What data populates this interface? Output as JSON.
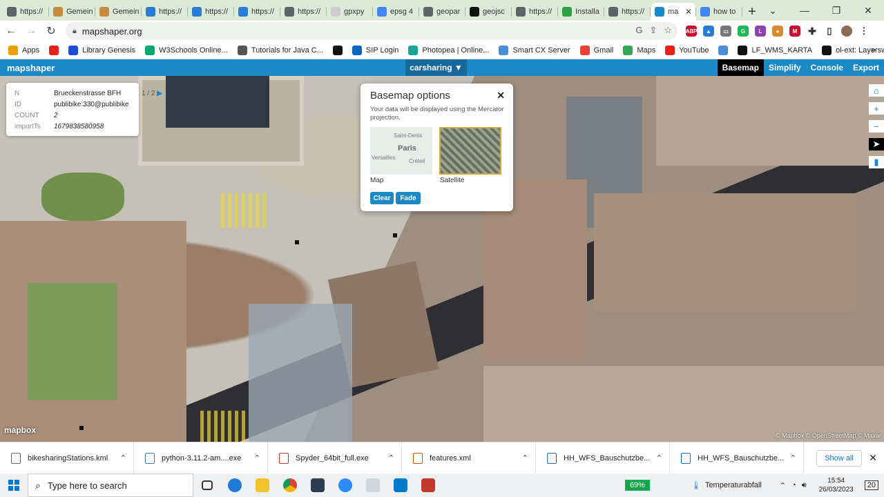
{
  "browser": {
    "tabs": [
      {
        "title": "https://",
        "color": "#5f6368",
        "icon": "globe-icon"
      },
      {
        "title": "Gemein",
        "color": "#c58a3c",
        "icon": "grid-icon"
      },
      {
        "title": "Gemein",
        "color": "#c58a3c",
        "icon": "grid-icon"
      },
      {
        "title": "https://",
        "color": "#2a7bd6",
        "icon": "bird-icon"
      },
      {
        "title": "https://",
        "color": "#2a7bd6",
        "icon": "bird-icon"
      },
      {
        "title": "https://",
        "color": "#2a7bd6",
        "icon": "bird-icon"
      },
      {
        "title": "https://",
        "color": "#5f6368",
        "icon": "globe-icon"
      },
      {
        "title": "gpxpy",
        "color": "#cccccc",
        "icon": "blank-icon"
      },
      {
        "title": "epsg 4",
        "color": "#4285f4",
        "icon": "google-icon"
      },
      {
        "title": "geopar",
        "color": "#5f6368",
        "icon": "globe-icon"
      },
      {
        "title": "geojsc",
        "color": "#111111",
        "icon": "github-icon"
      },
      {
        "title": "https://",
        "color": "#5f6368",
        "icon": "globe-icon"
      },
      {
        "title": "Installa",
        "color": "#2ea043",
        "icon": "r-icon"
      },
      {
        "title": "https://",
        "color": "#5f6368",
        "icon": "globe-icon"
      },
      {
        "title": "ma",
        "color": "#1a89c6",
        "icon": "mapshaper-icon",
        "active": true
      },
      {
        "title": "how to",
        "color": "#4285f4",
        "icon": "google-icon"
      }
    ],
    "url": "mapshaper.org",
    "bookmarks": [
      {
        "label": "Apps",
        "color": "#e8a200",
        "icon": "apps-icon"
      },
      {
        "label": "",
        "color": "#e62117",
        "icon": "youtube-icon"
      },
      {
        "label": "Library Genesis",
        "color": "#1d4ed8",
        "icon": "book-icon"
      },
      {
        "label": "W3Schools Online...",
        "color": "#04aa6d",
        "icon": "w3schools-icon"
      },
      {
        "label": "Tutorials for Java C...",
        "color": "#555555",
        "icon": "diamond-icon"
      },
      {
        "label": "",
        "color": "#111111",
        "icon": "globe-icon"
      },
      {
        "label": "SIP Login",
        "color": "#0a66c2",
        "icon": "linkedin-icon"
      },
      {
        "label": "Photopea | Online...",
        "color": "#18a497",
        "icon": "photopea-icon"
      },
      {
        "label": "Smart CX Server",
        "color": "#4b8fd6",
        "icon": "smartcx-icon"
      },
      {
        "label": "Gmail",
        "color": "#ea4335",
        "icon": "gmail-icon"
      },
      {
        "label": "Maps",
        "color": "#34a853",
        "icon": "maps-icon"
      },
      {
        "label": "YouTube",
        "color": "#e62117",
        "icon": "youtube-icon"
      },
      {
        "label": "",
        "color": "#4b8fd6",
        "icon": "bolt-icon"
      },
      {
        "label": "LF_WMS_KARTA",
        "color": "#111111",
        "icon": "globe-icon"
      },
      {
        "label": "ol-ext: Layerswitcher",
        "color": "#111111",
        "icon": "globe-icon"
      }
    ],
    "bookmarks_more": "»"
  },
  "app": {
    "logo": "mapshaper",
    "layer": "carsharing ▼",
    "menu": [
      "Basemap",
      "Simplify",
      "Console",
      "Export"
    ],
    "active_menu": "Basemap"
  },
  "info": {
    "rows": [
      {
        "key": "N",
        "value": "Brueckenstrasse BFH"
      },
      {
        "key": "ID",
        "value": "publibike:330@publibike"
      },
      {
        "key": "COUNT",
        "value": "2"
      },
      {
        "key": "importTs",
        "value": "1679838580958"
      }
    ],
    "pager": "1 / 2"
  },
  "basemap": {
    "title": "Basemap options",
    "close": "✕",
    "description": "Your data will be displayed using the Mercator projection.",
    "options": [
      {
        "label": "Map",
        "selected": false
      },
      {
        "label": "Satellite",
        "selected": true
      }
    ],
    "map_thumb_labels": [
      "Saint-Denis",
      "Paris",
      "Versailles",
      "Créteil"
    ],
    "buttons": [
      "Clear",
      "Fade"
    ]
  },
  "map": {
    "logo": "mapbox",
    "attribution": "© Mapbox © OpenStreetMap © Maxar"
  },
  "downloads": {
    "items": [
      "bikesharingStations.kml",
      "python-3.11.2-am....exe",
      "Spyder_64bit_full.exe",
      "features.xml",
      "HH_WFS_Bauschutzbe...",
      "HH_WFS_Bauschutzbe..."
    ],
    "show_all": "Show all"
  },
  "taskbar": {
    "search_placeholder": "Type here to search",
    "battery": "69%",
    "weather": "Temperaturabfall",
    "time": "15:54",
    "date": "26/03/2023",
    "notifications": "20"
  }
}
